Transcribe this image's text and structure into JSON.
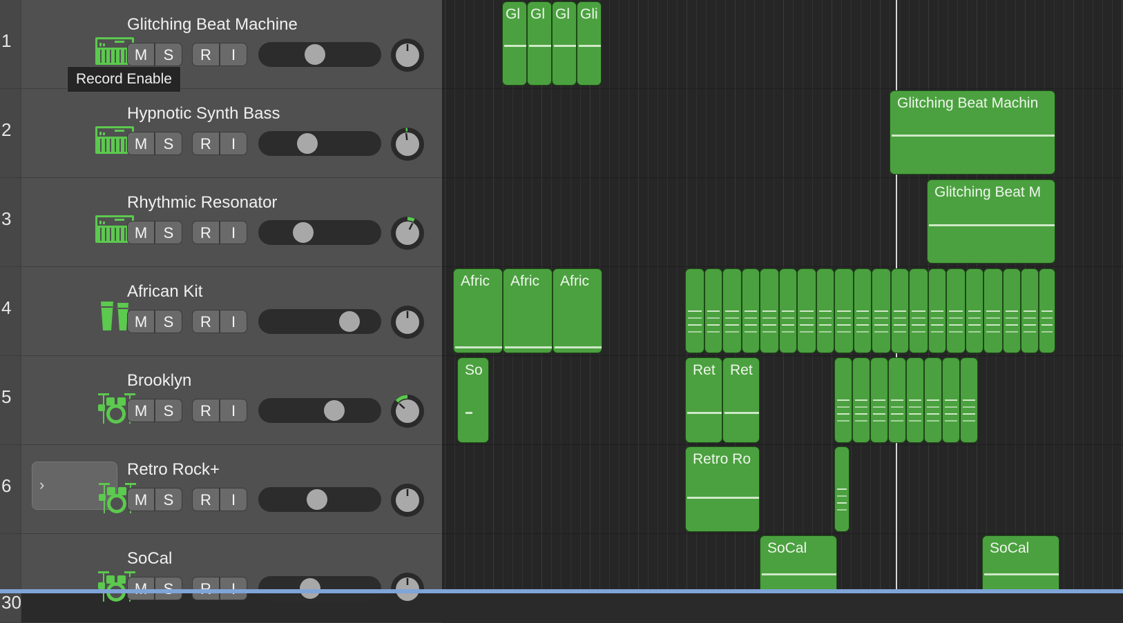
{
  "colors": {
    "region_green": "#4ba13f",
    "icon_green": "#5cc94f",
    "tooltip_bg": "#252525"
  },
  "tooltip": {
    "text": "Record Enable"
  },
  "button_labels": {
    "mute": "M",
    "solo": "S",
    "record": "R",
    "input": "I"
  },
  "tracks": [
    {
      "number": "1",
      "name": "Glitching Beat Machine",
      "icon": "keyboard-icon",
      "volume": 0.45,
      "pan": 0.0
    },
    {
      "number": "2",
      "name": "Hypnotic Synth Bass",
      "icon": "keyboard-icon",
      "volume": 0.37,
      "pan": -0.05
    },
    {
      "number": "3",
      "name": "Rhythmic Resonator",
      "icon": "keyboard-icon",
      "volume": 0.33,
      "pan": 0.2
    },
    {
      "number": "4",
      "name": "African Kit",
      "icon": "conga-icon",
      "volume": 0.81,
      "pan": 0.0
    },
    {
      "number": "5",
      "name": "Brooklyn",
      "icon": "drum-kit-icon",
      "volume": 0.65,
      "pan": -0.35
    },
    {
      "number": "6",
      "name": "Retro Rock+",
      "icon": "drum-kit-icon",
      "volume": 0.47,
      "pan": 0.0,
      "selected": true
    },
    {
      "number": "30",
      "name": "SoCal",
      "icon": "drum-kit-icon",
      "volume": 0.4,
      "pan": 0.0
    }
  ],
  "regions": [
    {
      "track": 0,
      "label": "Gl"
    },
    {
      "track": 0,
      "label": "Gl"
    },
    {
      "track": 0,
      "label": "Gl"
    },
    {
      "track": 0,
      "label": "Gli"
    },
    {
      "track": 1,
      "label": "Glitching Beat Machin"
    },
    {
      "track": 2,
      "label": "Glitching Beat M"
    },
    {
      "track": 3,
      "label": "Afric"
    },
    {
      "track": 3,
      "label": "Afric"
    },
    {
      "track": 3,
      "label": "Afric"
    },
    {
      "track": 4,
      "label": "So"
    },
    {
      "track": 4,
      "label": "Ret"
    },
    {
      "track": 4,
      "label": "Ret"
    },
    {
      "track": 5,
      "label": "Retro Ro"
    },
    {
      "track": 6,
      "label": "SoCal"
    },
    {
      "track": 6,
      "label": "SoCal"
    }
  ]
}
